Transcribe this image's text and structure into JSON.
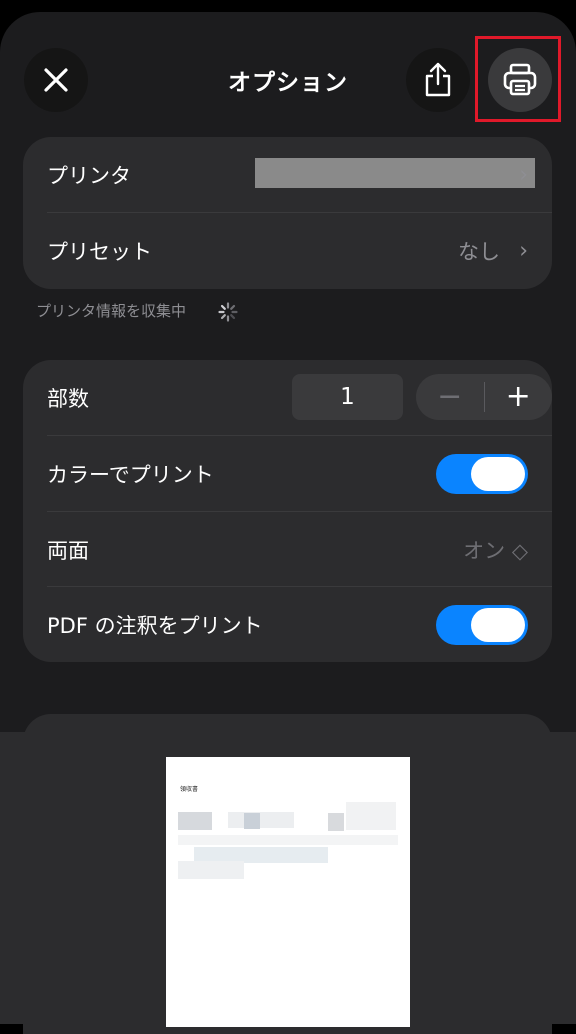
{
  "header": {
    "title": "オプション"
  },
  "printer_section": {
    "printer_label": "プリンタ",
    "preset_label": "プリセット",
    "preset_value": "なし",
    "chevron": "›"
  },
  "info_text": "プリンタ情報を収集中",
  "options": {
    "copies_label": "部数",
    "copies_value": "1",
    "minus": "−",
    "plus": "+",
    "color_label": "カラーでプリント",
    "color_on": true,
    "duplex_label": "両面",
    "duplex_value": "オン ◇",
    "pdf_annot_label": "PDF の注釈をプリント",
    "pdf_annot_on": true
  },
  "preview": {
    "doc_title": "領収書"
  },
  "colors": {
    "accent": "#0a84ff",
    "highlight": "#e0192a"
  }
}
